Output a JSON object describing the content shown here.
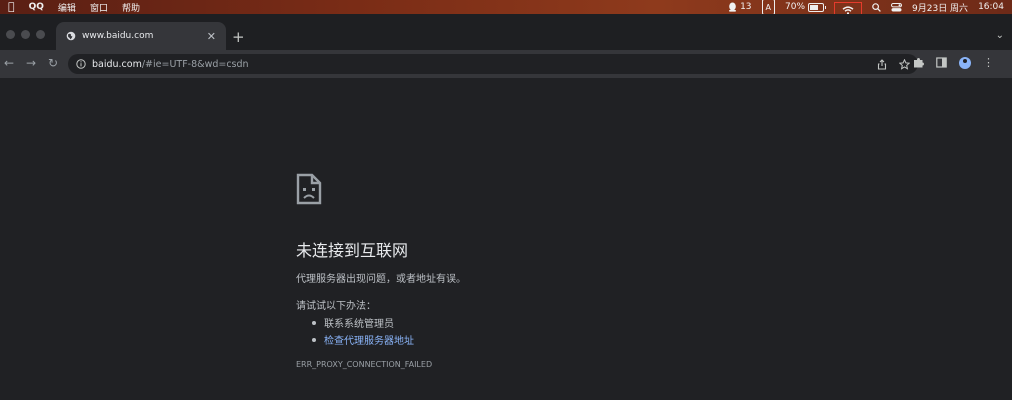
{
  "menubar": {
    "app_name": "QQ",
    "menus": [
      "编辑",
      "窗口",
      "帮助"
    ],
    "qq_count": "13",
    "input_method": "A",
    "battery_percent": "70%",
    "battery_level": 0.7,
    "datetime": "9月23日 周六",
    "time": "16:04",
    "highlight_color": "#e53b2c"
  },
  "browser": {
    "tab_title": "www.baidu.com",
    "new_tab": "+",
    "url_host": "baidu.com",
    "url_path": "/#ie=UTF-8&wd=csdn"
  },
  "error": {
    "title": "未连接到互联网",
    "description": "代理服务器出现问题，或者地址有误。",
    "try_label": "请试试以下办法：",
    "suggestions": [
      {
        "text": "联系系统管理员",
        "link": false
      },
      {
        "text": "检查代理服务器地址",
        "link": true
      }
    ],
    "code": "ERR_PROXY_CONNECTION_FAILED",
    "link_color": "#8ab4f8"
  }
}
